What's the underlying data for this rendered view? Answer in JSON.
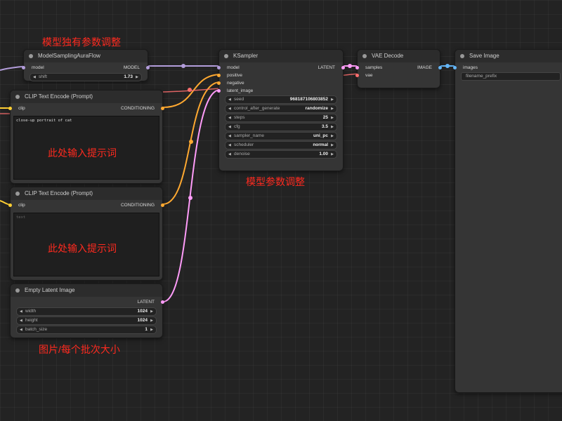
{
  "colors": {
    "model_wire": "#b39ddb",
    "clip_wire": "#ffcf33",
    "conditioning_wire": "#ffa931",
    "latent_wire": "#ff9cf9",
    "vae_wire": "#ff6e6e",
    "image_wire": "#64b5f6",
    "annotation": "#ff2a1f"
  },
  "annotations": {
    "model_sampling": "模型独有参数调整",
    "prompt1": "此处输入提示词",
    "prompt2": "此处输入提示词",
    "ksampler": "模型参数调整",
    "latent": "图片/每个批次大小"
  },
  "model_sampling": {
    "title": "ModelSamplingAuraFlow",
    "input": "model",
    "output": "MODEL",
    "shift_label": "shift",
    "shift_value": "1.73"
  },
  "clip1": {
    "title": "CLIP Text Encode (Prompt)",
    "input": "clip",
    "output": "CONDITIONING",
    "text": "close-up portrait of cat"
  },
  "clip2": {
    "title": "CLIP Text Encode (Prompt)",
    "input": "clip",
    "output": "CONDITIONING",
    "text": "text"
  },
  "latent": {
    "title": "Empty Latent Image",
    "output": "LATENT",
    "width_label": "width",
    "width_value": "1024",
    "height_label": "height",
    "height_value": "1024",
    "batch_label": "batch_size",
    "batch_value": "1"
  },
  "ksampler": {
    "title": "KSampler",
    "inputs": [
      "model",
      "positive",
      "negative",
      "latent_image"
    ],
    "output": "LATENT",
    "widgets": [
      {
        "name": "seed",
        "value": "968187106803852"
      },
      {
        "name": "control_after_generate",
        "value": "randomize"
      },
      {
        "name": "steps",
        "value": "25"
      },
      {
        "name": "cfg",
        "value": "3.5"
      },
      {
        "name": "sampler_name",
        "value": "uni_pc"
      },
      {
        "name": "scheduler",
        "value": "normal"
      },
      {
        "name": "denoise",
        "value": "1.00"
      }
    ]
  },
  "vae_decode": {
    "title": "VAE Decode",
    "inputs": [
      "samples",
      "vae"
    ],
    "output": "IMAGE"
  },
  "save_image": {
    "title": "Save Image",
    "input": "images",
    "filename_label": "filename_prefix"
  },
  "icons": {
    "arrow_left": "◀",
    "arrow_right": "▶"
  }
}
